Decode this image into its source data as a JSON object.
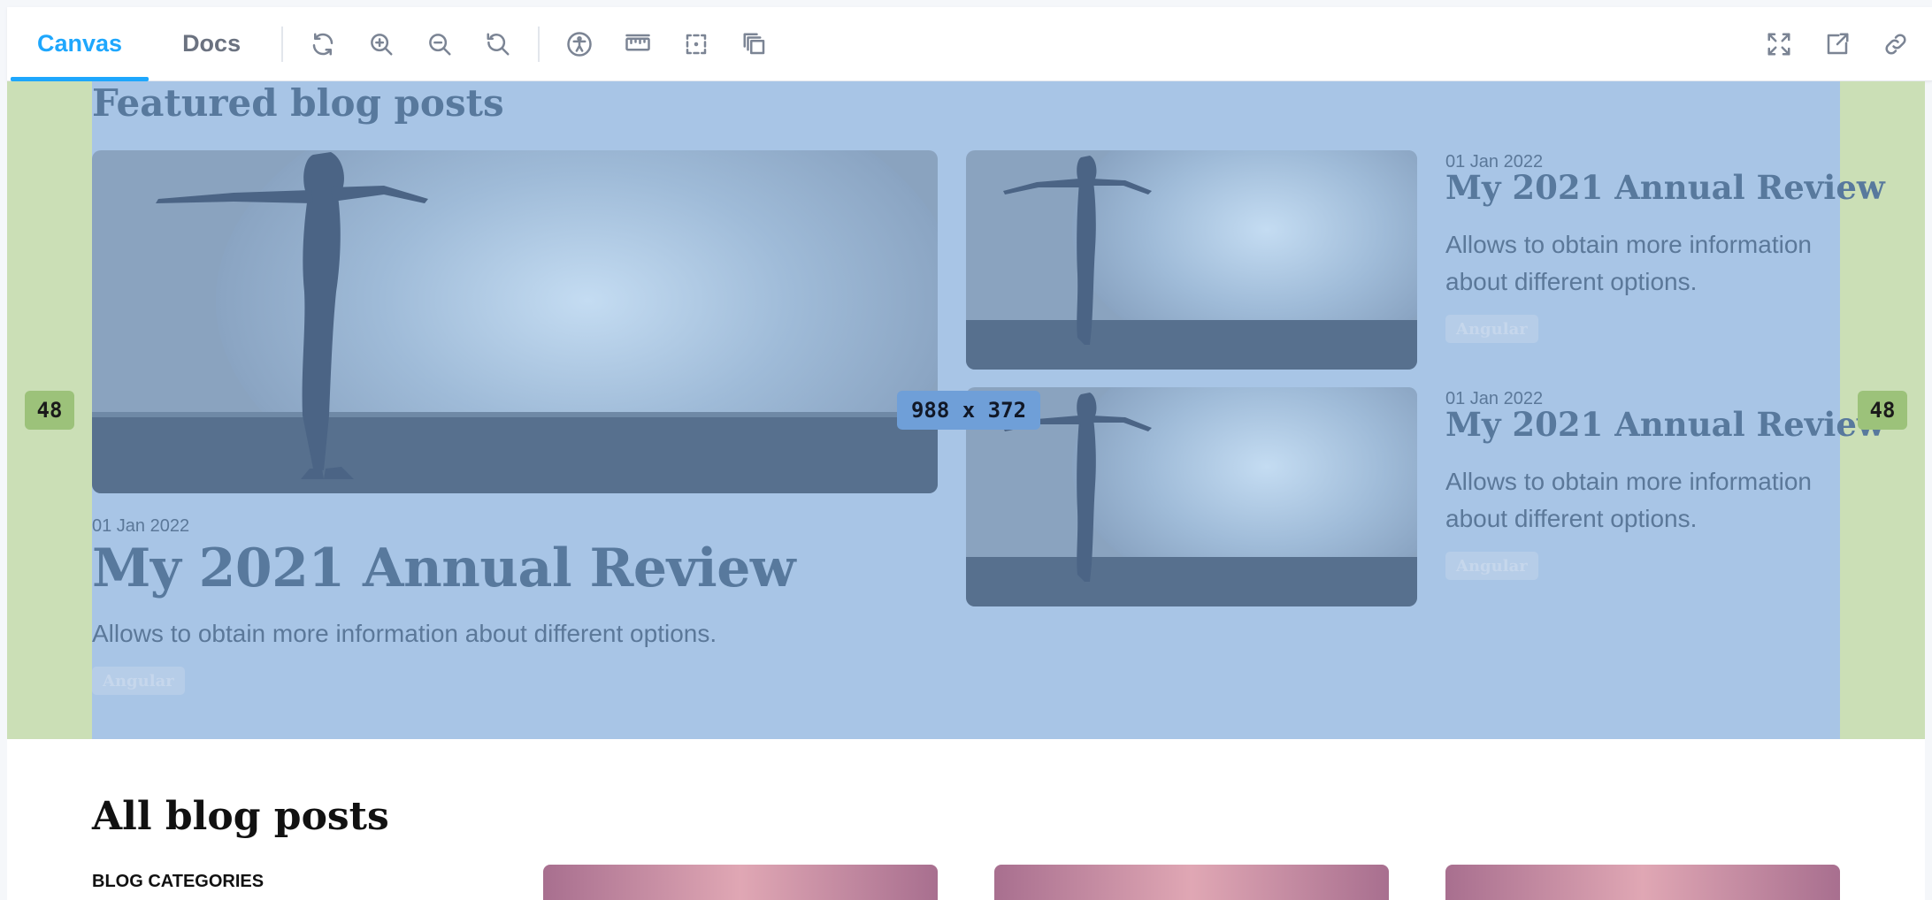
{
  "toolbar": {
    "tabs": [
      {
        "label": "Canvas",
        "active": true
      },
      {
        "label": "Docs",
        "active": false
      }
    ],
    "tools": [
      "reload-icon",
      "zoom-in-icon",
      "zoom-out-icon",
      "zoom-reset-icon",
      "accessibility-icon",
      "ruler-icon",
      "outline-icon",
      "layers-icon"
    ],
    "right_tools": [
      "fullscreen-icon",
      "open-new-tab-icon",
      "copy-link-icon"
    ]
  },
  "measure": {
    "margin_left": "48",
    "margin_right": "48",
    "size": "988 x 372"
  },
  "featured": {
    "heading": "Featured blog posts",
    "main_post": {
      "date": "01 Jan 2022",
      "title": "My 2021 Annual Review",
      "excerpt": "Allows to obtain more information about different options.",
      "tag": "Angular"
    },
    "side_posts": [
      {
        "date": "01 Jan 2022",
        "title": "My 2021 Annual Review",
        "excerpt_line1": "Allows to obtain more information",
        "excerpt_line2": "about different options.",
        "tag": "Angular"
      },
      {
        "date": "01 Jan 2022",
        "title": "My 2021 Annual Review",
        "excerpt_line1": "Allows to obtain more information",
        "excerpt_line2": "about different options.",
        "tag": "Angular"
      }
    ]
  },
  "all_posts": {
    "heading": "All blog posts",
    "categories_label": "BLOG CATEGORIES"
  },
  "colors": {
    "accent": "#1ea7fd",
    "margin_overlay": "#cbdfb6",
    "content_overlay": "#a8c5e6"
  }
}
